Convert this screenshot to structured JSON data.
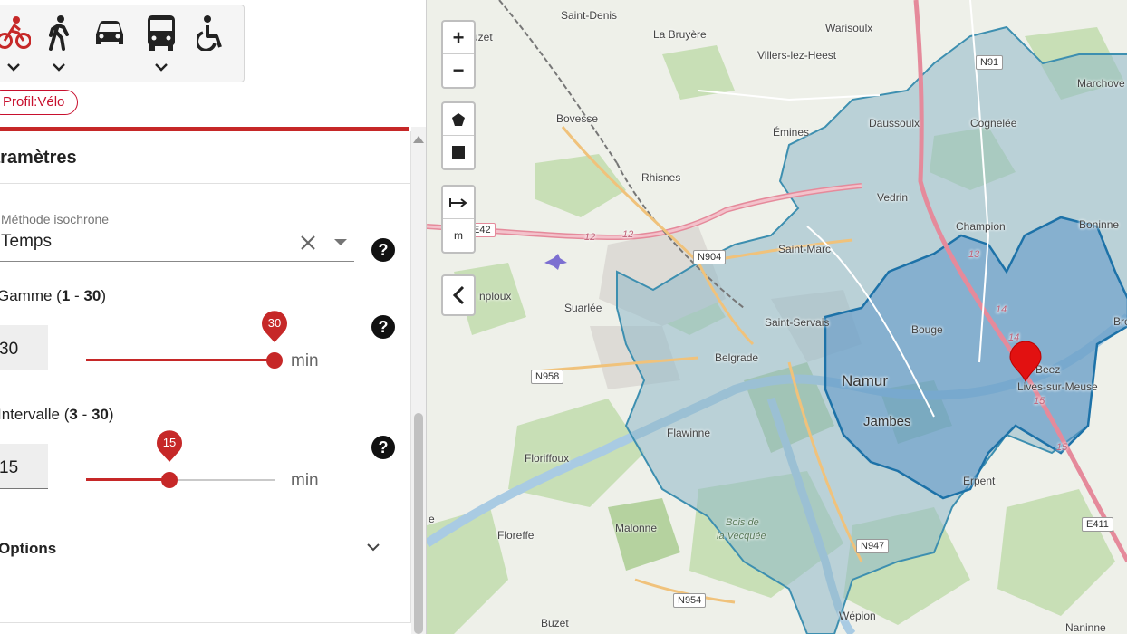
{
  "transport_modes": [
    {
      "name": "bike",
      "active": true,
      "has_dropdown": true
    },
    {
      "name": "walk",
      "active": false,
      "has_dropdown": true
    },
    {
      "name": "car",
      "active": false,
      "has_dropdown": false
    },
    {
      "name": "bus",
      "active": false,
      "has_dropdown": true
    },
    {
      "name": "wheelchair",
      "active": false,
      "has_dropdown": false
    }
  ],
  "profile_chip": "Profil:Vélo",
  "settings": {
    "title": "aramètres",
    "method_label": "Méthode isochrone",
    "method_value": "Temps",
    "range": {
      "label": "Gamme (",
      "min": "1",
      "sep": " - ",
      "max": "30",
      "close": ")",
      "value": "30",
      "pin": "30",
      "unit": "min",
      "fraction": 1.0
    },
    "interval": {
      "label": "Intervalle (",
      "min": "3",
      "sep": " - ",
      "max": "30",
      "close": ")",
      "value": "15",
      "pin": "15",
      "unit": "min",
      "fraction": 0.44
    },
    "options_label": "Options"
  },
  "map": {
    "zoom_in": "+",
    "zoom_out": "−",
    "measure_unit": "m",
    "places": {
      "saint_denis": "Saint-Denis",
      "la_bruyere": "La Bruyère",
      "warisoulx": "Warisoulx",
      "villers": "Villers-lez-Heest",
      "marchovelette": "Marchove",
      "buzet_top": "uzet",
      "bovesse": "Bovesse",
      "daussoulx": "Daussoulx",
      "cognelee": "Cognelée",
      "emines": "Émines",
      "rhisnes": "Rhisnes",
      "vedrin": "Vedrin",
      "champion": "Champion",
      "boninne": "Boninne",
      "saint_marc": "Saint-Marc",
      "temploux": "nploux",
      "suarlee": "Suarlée",
      "saint_servais": "Saint-Servais",
      "bouge": "Bouge",
      "belgrade": "Belgrade",
      "namur": "Namur",
      "beez": "Beez",
      "lives": "Lives-sur-Meuse",
      "jambes": "Jambes",
      "flawinne": "Flawinne",
      "erpent": "Erpent",
      "floriffoux": "Floriffoux",
      "floreffe": "Floreffe",
      "malonne": "Malonne",
      "bois": "Bois de",
      "vecquee": "la Vecquée",
      "wepion": "Wépion",
      "naninne": "Naninne",
      "buzet_bottom": "Buzet",
      "bre": "Bre",
      "le": "e"
    },
    "roads": {
      "n91": "N91",
      "e42": "E42",
      "n904": "N904",
      "n958": "N958",
      "n947": "N947",
      "n954": "N954",
      "e411": "E411",
      "km12a": "12",
      "km12b": "12",
      "km13": "13",
      "km14a": "14",
      "km14b": "14",
      "km15a": "15",
      "km15b": "15"
    },
    "colors": {
      "accent": "#c62828",
      "isochrone_outer": "#8fb8c9",
      "isochrone_inner": "#5b95c8",
      "isochrone_stroke": "#2e7fb0"
    }
  }
}
